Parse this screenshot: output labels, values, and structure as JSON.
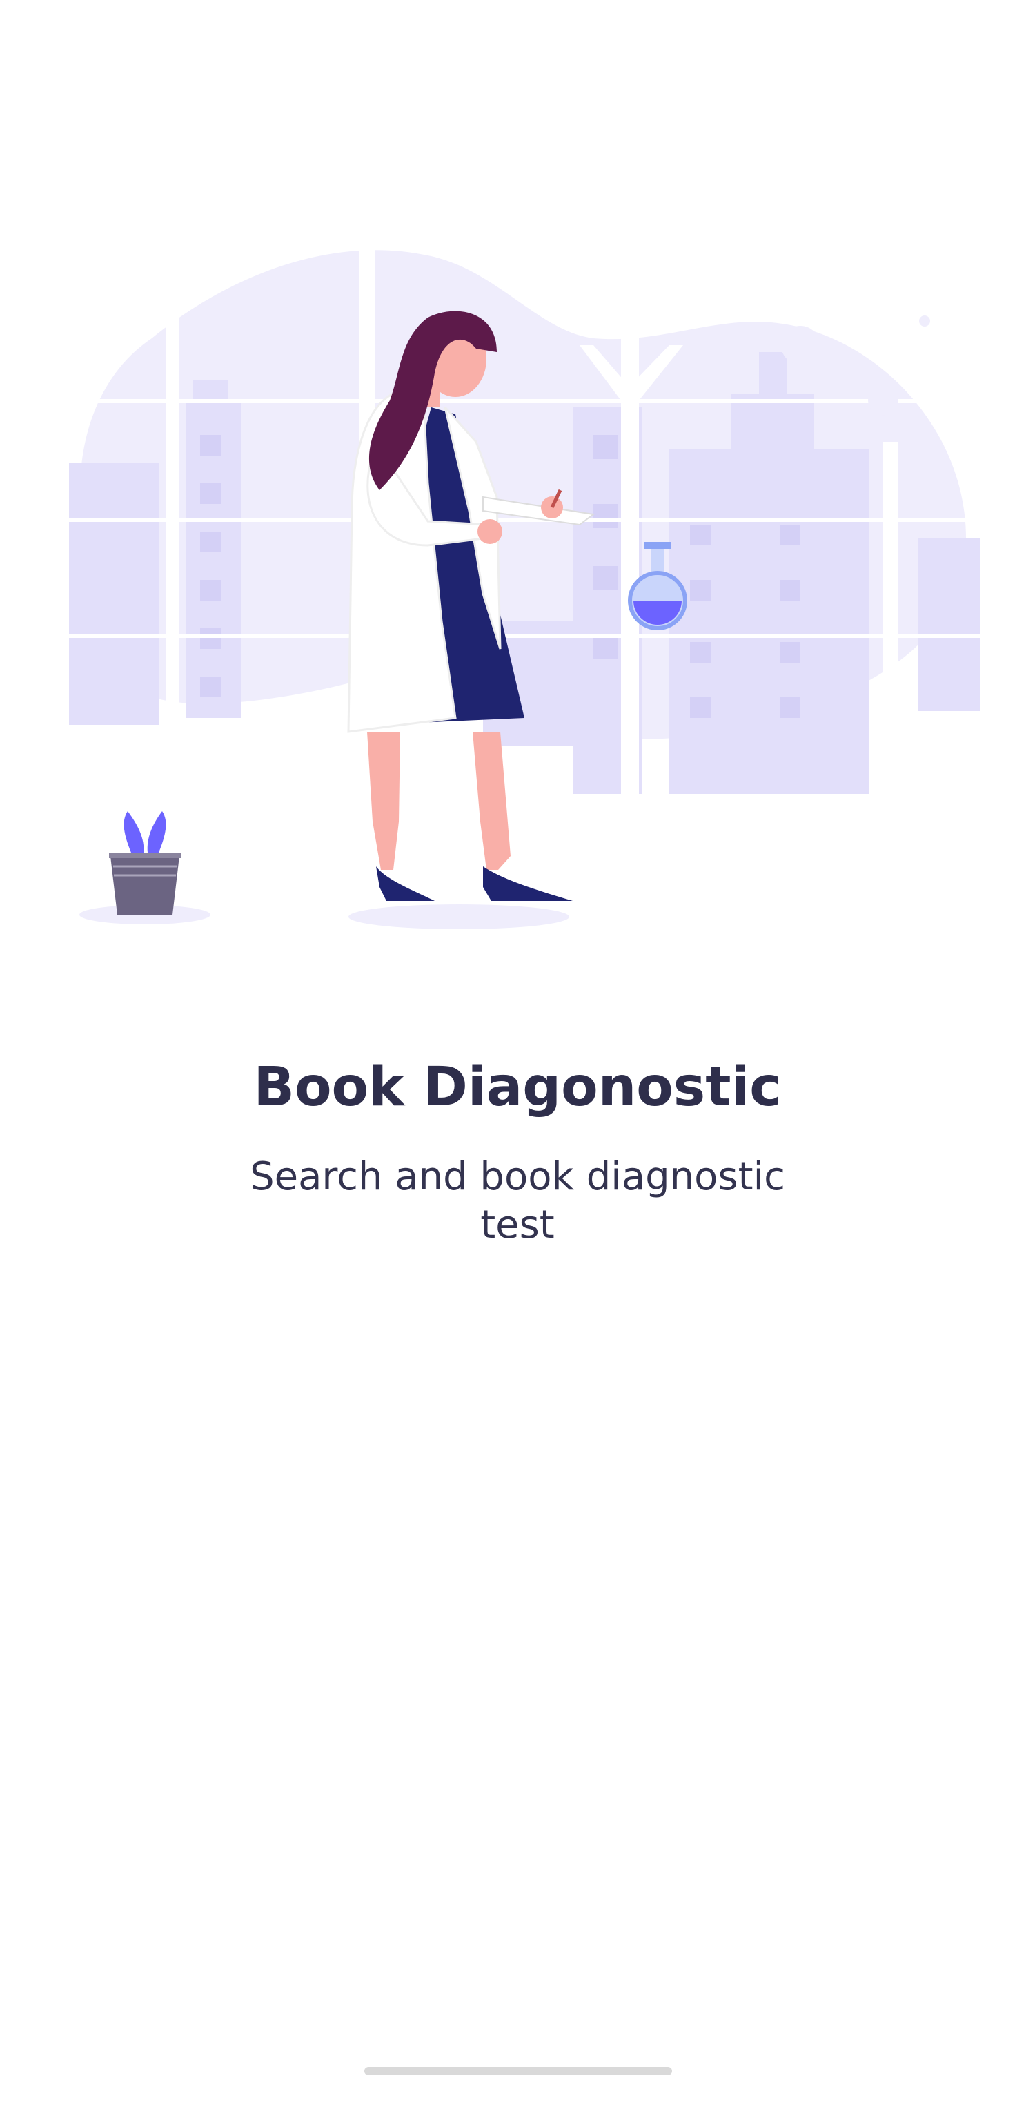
{
  "onboarding": {
    "title": "Book Diagonostic",
    "subtitle": "Search and book diagnostic test"
  },
  "illustration": {
    "name": "doctor-with-flask-illustration",
    "colors": {
      "background_blob": "#efedfc",
      "buildings": "#e2dffa",
      "hair": "#5d1a4a",
      "skin": "#f9afa8",
      "coat": "#ffffff",
      "dress": "#1f2470",
      "flask_liquid": "#6c63ff",
      "pot": "#6b6482"
    }
  },
  "colors": {
    "title_text": "#2e2e4b",
    "subtitle_text": "#33334f",
    "home_indicator": "#d9d9d9"
  }
}
